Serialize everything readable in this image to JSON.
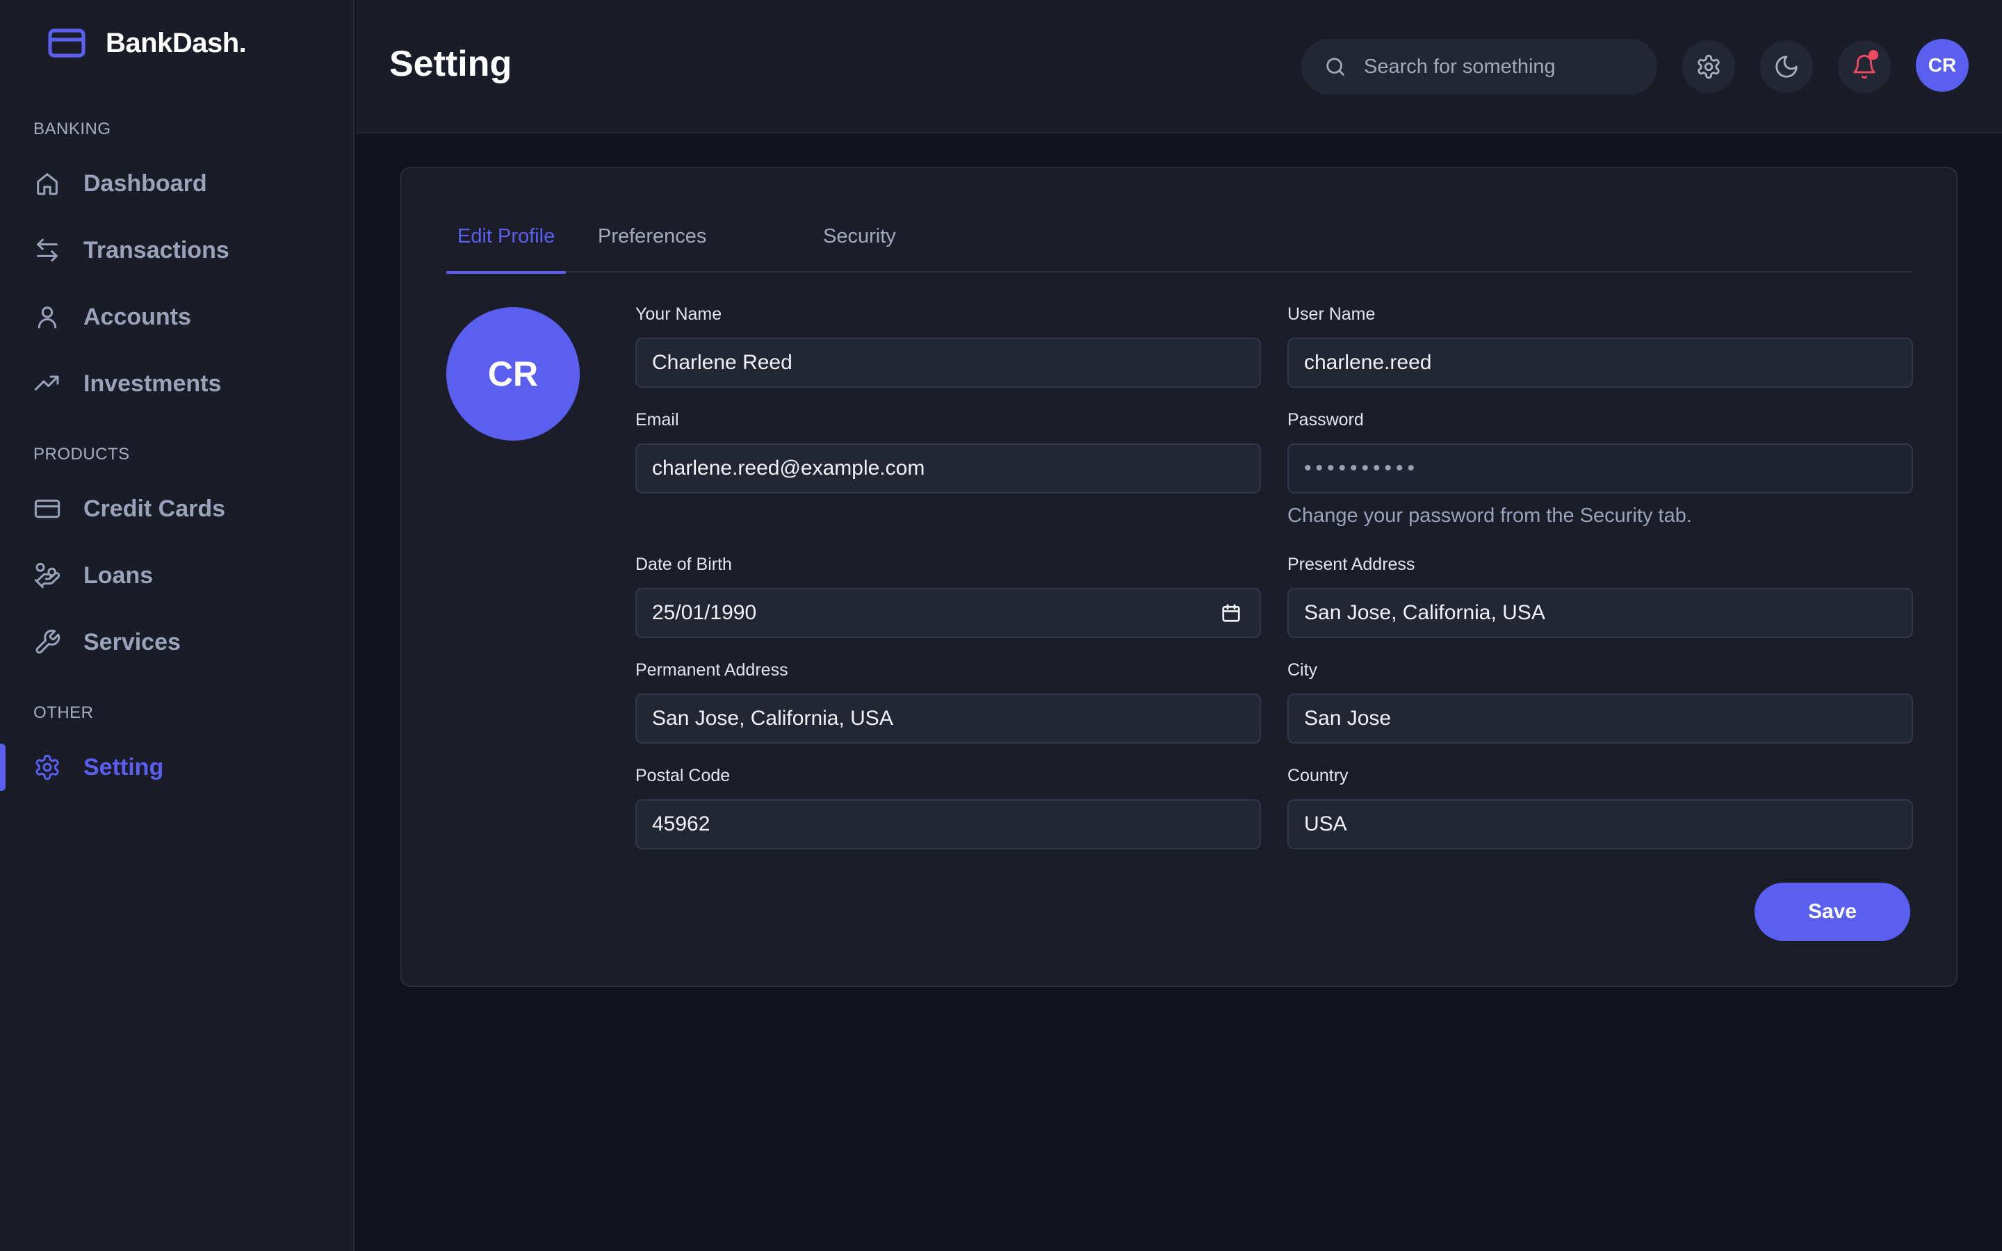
{
  "brand": {
    "name": "BankDash."
  },
  "sidebar": {
    "sections": [
      {
        "label": "BANKING"
      },
      {
        "label": "PRODUCTS"
      },
      {
        "label": "OTHER"
      }
    ],
    "items": [
      {
        "label": "Dashboard",
        "icon": "home-icon"
      },
      {
        "label": "Transactions",
        "icon": "arrows-swap-icon"
      },
      {
        "label": "Accounts",
        "icon": "user-icon"
      },
      {
        "label": "Investments",
        "icon": "trending-up-icon"
      },
      {
        "label": "Credit Cards",
        "icon": "credit-card-icon"
      },
      {
        "label": "Loans",
        "icon": "hand-coins-icon"
      },
      {
        "label": "Services",
        "icon": "wrench-icon"
      },
      {
        "label": "Setting",
        "icon": "gear-icon",
        "active": true
      }
    ]
  },
  "header": {
    "title": "Setting",
    "search_placeholder": "Search for something",
    "avatar_initials": "CR"
  },
  "tabs": [
    {
      "label": "Edit Profile",
      "active": true
    },
    {
      "label": "Preferences"
    },
    {
      "label": "Security"
    }
  ],
  "profile": {
    "avatar_initials": "CR",
    "fields": {
      "your_name": {
        "label": "Your Name",
        "value": "Charlene Reed"
      },
      "user_name": {
        "label": "User Name",
        "value": "charlene.reed"
      },
      "email": {
        "label": "Email",
        "value": "charlene.reed@example.com"
      },
      "password": {
        "label": "Password",
        "value": "••••••••••"
      },
      "date_of_birth": {
        "label": "Date of Birth",
        "value": "25/01/1990"
      },
      "present_address": {
        "label": "Present Address",
        "value": "San Jose, California, USA"
      },
      "permanent_address": {
        "label": "Permanent Address",
        "value": "San Jose, California, USA"
      },
      "city": {
        "label": "City",
        "value": "San Jose"
      },
      "postal_code": {
        "label": "Postal Code",
        "value": "45962"
      },
      "country": {
        "label": "Country",
        "value": "USA"
      }
    },
    "password_hint": "Change your password from the Security tab.",
    "save_label": "Save"
  },
  "colors": {
    "accent": "#5b5ff0",
    "sidebar_bg": "#1a1c28",
    "page_bg": "#10131c",
    "card_bg": "#1b1d29",
    "input_bg": "#232633",
    "notification": "#f04a63"
  }
}
